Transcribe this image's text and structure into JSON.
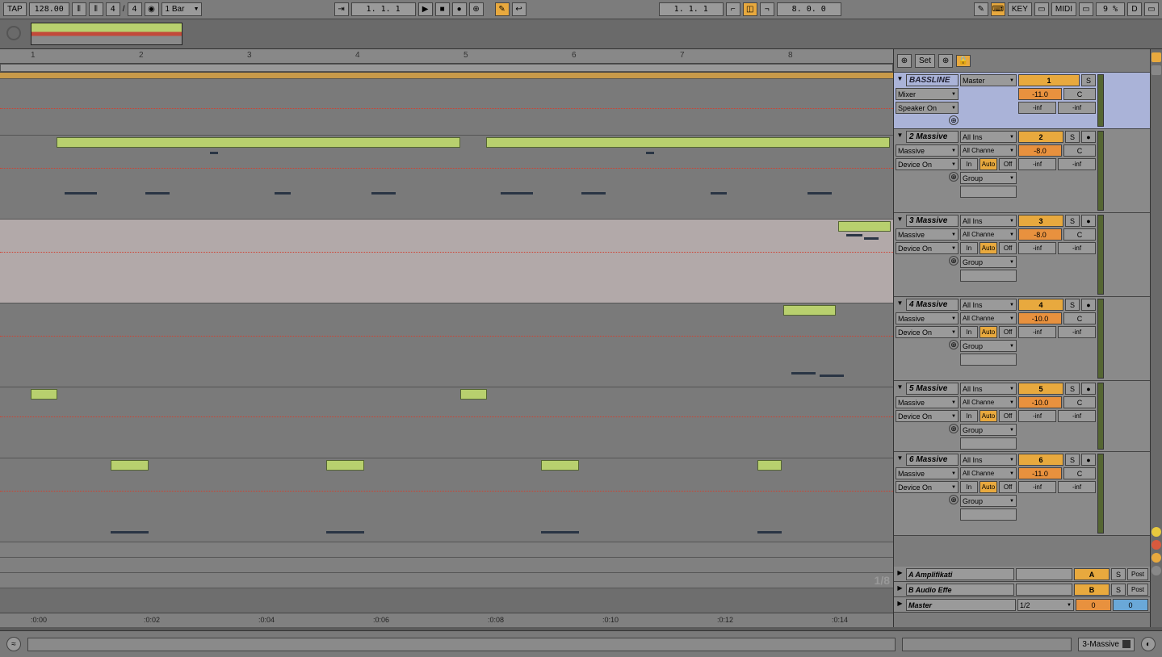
{
  "toolbar": {
    "tap": "TAP",
    "tempo": "128.00",
    "sig_num": "4",
    "sig_den": "4",
    "quantize": "1 Bar",
    "position": "1.  1.  1",
    "loop_pos": "1.  1.  1",
    "loop_len": "8.  0.  0",
    "key": "KEY",
    "midi": "MIDI",
    "cpu": "9 %",
    "d": "D"
  },
  "ruler": [
    "1",
    "2",
    "3",
    "4",
    "5",
    "6",
    "7",
    "8"
  ],
  "timeline": [
    ":0:00",
    ":0:02",
    ":0:04",
    ":0:06",
    ":0:08",
    ":0:10",
    ":0:12",
    ":0:14"
  ],
  "zoom": "1/8",
  "set_label": "Set",
  "tracks": [
    {
      "name": "BASSLINE",
      "num": "1",
      "route": "Master",
      "sub1": "Mixer",
      "sub2": "Speaker On",
      "pan": "C",
      "vol": "-11.0",
      "sends": [
        "-inf",
        "-inf"
      ],
      "selected": true,
      "io": false
    },
    {
      "name": "2 Massive",
      "num": "2",
      "route": "All Ins",
      "ch": "All Channe",
      "sub1": "Massive",
      "sub2": "Device On",
      "pan": "C",
      "vol": "-8.0",
      "sends": [
        "-inf",
        "-inf"
      ],
      "grp": "Group",
      "io": true
    },
    {
      "name": "3 Massive",
      "num": "3",
      "route": "All Ins",
      "ch": "All Channe",
      "sub1": "Massive",
      "sub2": "Device On",
      "pan": "C",
      "vol": "-8.0",
      "sends": [
        "-inf",
        "-inf"
      ],
      "grp": "Group",
      "io": true
    },
    {
      "name": "4 Massive",
      "num": "4",
      "route": "All Ins",
      "ch": "All Channe",
      "sub1": "Massive",
      "sub2": "Device On",
      "pan": "C",
      "vol": "-10.0",
      "sends": [
        "-inf",
        "-inf"
      ],
      "grp": "Group",
      "io": true
    },
    {
      "name": "5 Massive",
      "num": "5",
      "route": "All Ins",
      "ch": "All Channe",
      "sub1": "Massive",
      "sub2": "Device On",
      "pan": "C",
      "vol": "-10.0",
      "sends": [
        "-inf",
        "-inf"
      ],
      "grp": "Group",
      "io": true
    },
    {
      "name": "6 Massive",
      "num": "6",
      "route": "All Ins",
      "ch": "All Channe",
      "sub1": "Massive",
      "sub2": "Device On",
      "pan": "C",
      "vol": "-11.0",
      "sends": [
        "-inf",
        "-inf"
      ],
      "grp": "Group",
      "io": true
    }
  ],
  "returns": [
    {
      "name": "A Amplifikati",
      "num": "A",
      "post": "Post"
    },
    {
      "name": "B Audio Effe",
      "num": "B",
      "post": "Post"
    }
  ],
  "master": {
    "name": "Master",
    "cue": "1/2",
    "a": "0",
    "b": "0"
  },
  "io_labels": {
    "in": "In",
    "auto": "Auto",
    "off": "Off",
    "s": "S",
    "c": "C"
  },
  "device_title": "3-Massive"
}
